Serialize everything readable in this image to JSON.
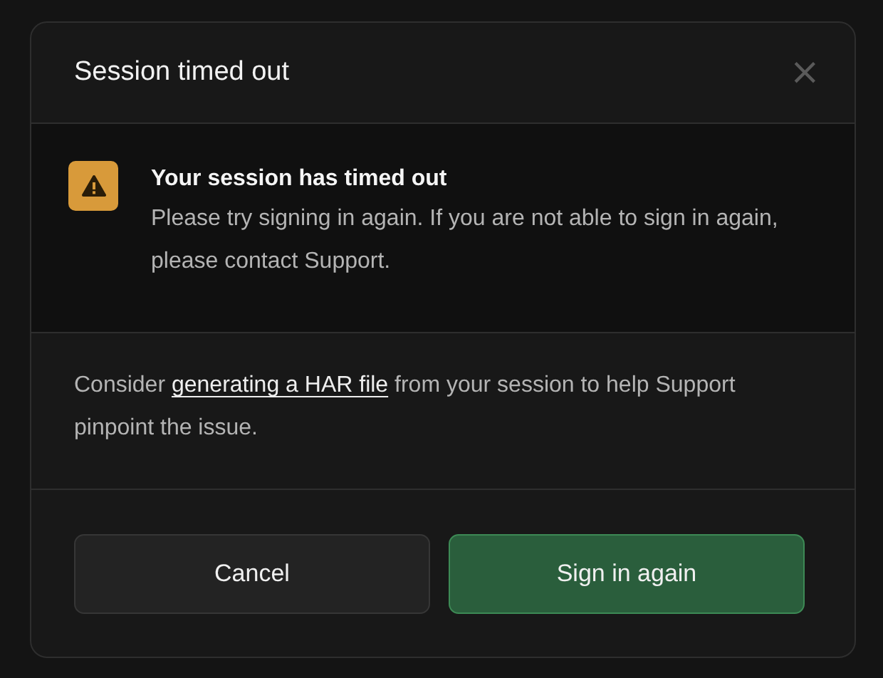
{
  "dialog": {
    "title": "Session timed out",
    "close": "×",
    "alert": {
      "kind": "warning",
      "title": "Your session has timed out",
      "message": "Please try signing in again. If you are not able to sign in again, please contact Support."
    },
    "note": {
      "before": "Consider",
      "link": "generating a HAR file",
      "after": "from your session to help Support pinpoint the issue."
    },
    "buttons": [
      {
        "label": "Cancel",
        "kind": "secondary"
      },
      {
        "label": "Sign in again",
        "kind": "primary"
      }
    ]
  }
}
